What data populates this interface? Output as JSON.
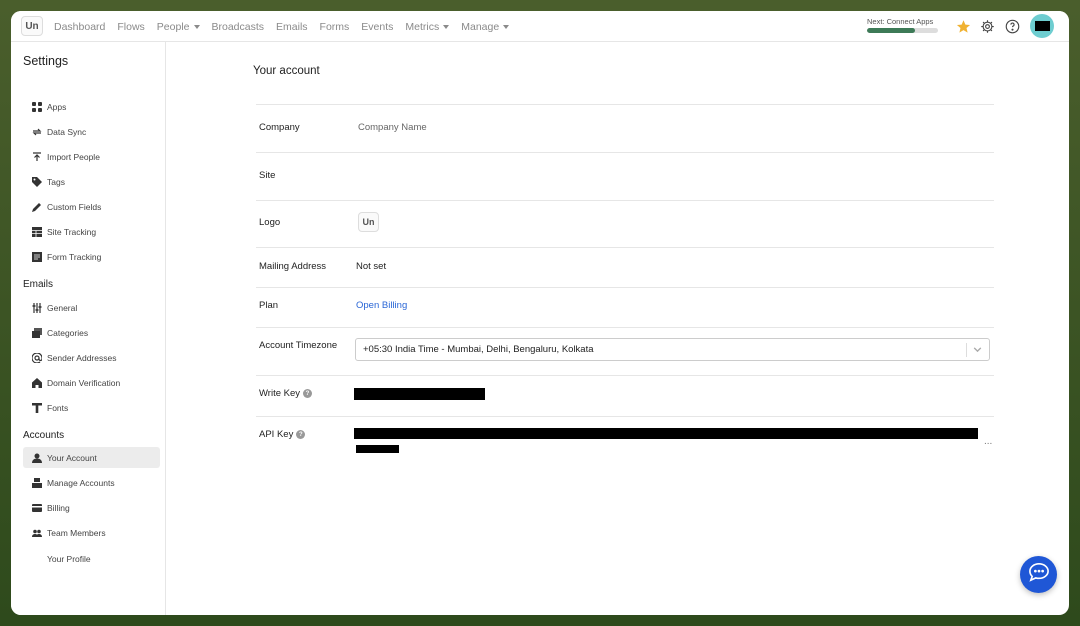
{
  "app": {
    "logo_text": "Un"
  },
  "nav": {
    "items": [
      {
        "label": "Dashboard",
        "dropdown": false
      },
      {
        "label": "Flows",
        "dropdown": false
      },
      {
        "label": "People",
        "dropdown": true
      },
      {
        "label": "Broadcasts",
        "dropdown": false
      },
      {
        "label": "Emails",
        "dropdown": false
      },
      {
        "label": "Forms",
        "dropdown": false
      },
      {
        "label": "Events",
        "dropdown": false
      },
      {
        "label": "Metrics",
        "dropdown": true
      },
      {
        "label": "Manage",
        "dropdown": true
      }
    ],
    "progress": {
      "label": "Next: Connect Apps",
      "fraction": 0.67,
      "color": "#3d7a57"
    },
    "icons": [
      "star-icon",
      "gear-icon",
      "help-icon"
    ],
    "star_color": "#f0b232"
  },
  "sidebar": {
    "title": "Settings",
    "sections": [
      {
        "label": "",
        "items": [
          {
            "label": "Apps",
            "icon": "apps-icon"
          },
          {
            "label": "Data Sync",
            "icon": "sync-icon"
          },
          {
            "label": "Import People",
            "icon": "import-icon"
          },
          {
            "label": "Tags",
            "icon": "tag-icon"
          },
          {
            "label": "Custom Fields",
            "icon": "pencil-icon"
          },
          {
            "label": "Site Tracking",
            "icon": "table-icon"
          },
          {
            "label": "Form Tracking",
            "icon": "form-icon"
          }
        ]
      },
      {
        "label": "Emails",
        "items": [
          {
            "label": "General",
            "icon": "sliders-icon"
          },
          {
            "label": "Categories",
            "icon": "categories-icon"
          },
          {
            "label": "Sender Addresses",
            "icon": "at-icon"
          },
          {
            "label": "Domain Verification",
            "icon": "home-icon"
          },
          {
            "label": "Fonts",
            "icon": "font-icon"
          }
        ]
      },
      {
        "label": "Accounts",
        "items": [
          {
            "label": "Your Account",
            "icon": "user-icon",
            "active": true
          },
          {
            "label": "Manage Accounts",
            "icon": "accounts-icon"
          },
          {
            "label": "Billing",
            "icon": "card-icon"
          },
          {
            "label": "Team Members",
            "icon": "team-icon"
          },
          {
            "label": "Your Profile",
            "icon": ""
          }
        ]
      }
    ]
  },
  "main": {
    "title": "Your account",
    "company": {
      "label": "Company",
      "placeholder": "Company Name"
    },
    "site": {
      "label": "Site",
      "value": ""
    },
    "logo": {
      "label": "Logo",
      "value": "Un"
    },
    "mailing_address": {
      "label": "Mailing Address",
      "value": "Not set"
    },
    "plan": {
      "label": "Plan",
      "link": "Open Billing"
    },
    "timezone": {
      "label": "Account Timezone",
      "value": "+05:30 India Time - Mumbai, Delhi, Bengaluru, Kolkata"
    },
    "write_key": {
      "label": "Write Key"
    },
    "api_key": {
      "label": "API Key",
      "more": "..."
    }
  },
  "chat": {
    "icon": "chat-icon",
    "color": "#1f57d6"
  }
}
